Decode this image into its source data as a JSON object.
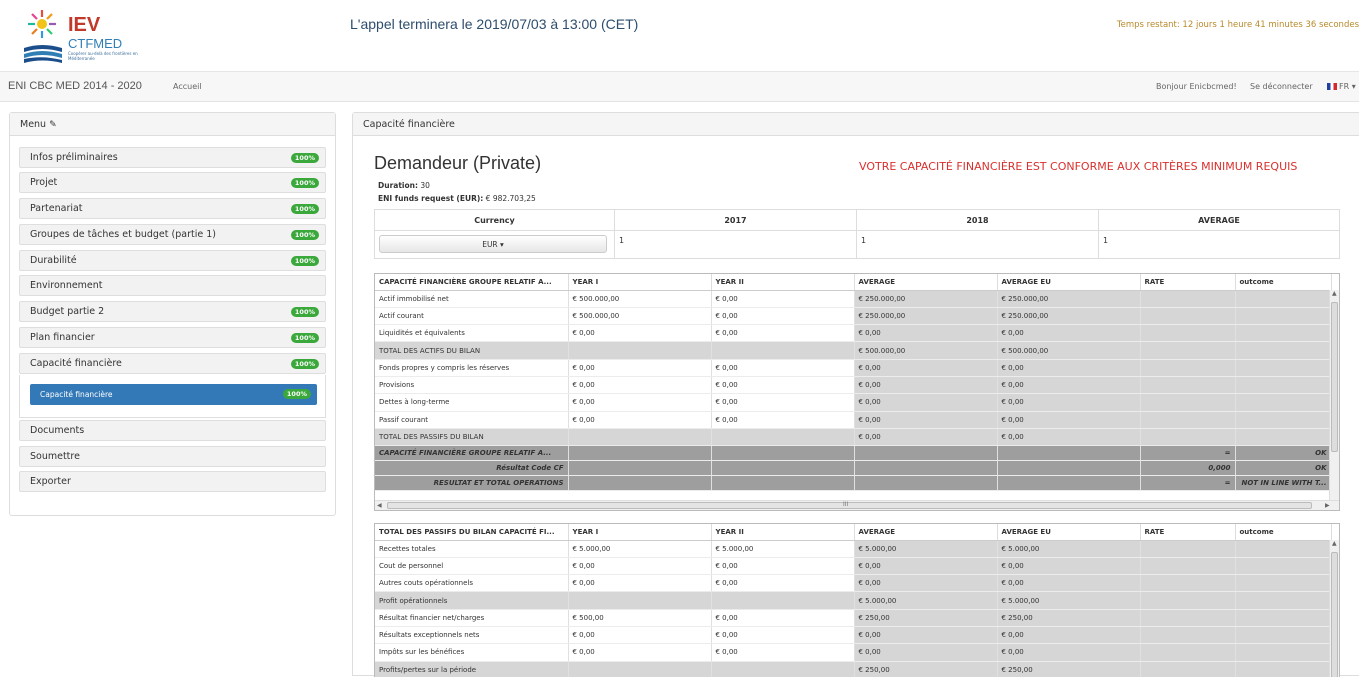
{
  "header": {
    "logo_title": "IEV",
    "logo_subtitle": "CTFMED",
    "logo_tagline": "Coopérer au-delà des frontières en Méditerranée",
    "call_deadline": "L'appel terminera le 2019/07/03 à 13:00 (CET)",
    "time_left": "Temps restant: 12 jours 1 heure 41 minutes 36 secondes"
  },
  "navbar": {
    "brand": "ENI CBC MED 2014 - 2020",
    "home": "Accueil",
    "greeting": "Bonjour Enicbcmed!",
    "logout": "Se déconnecter",
    "language": "FR ▾"
  },
  "menu": {
    "title": "Menu",
    "items": [
      {
        "label": "Infos préliminaires",
        "badge": "100%"
      },
      {
        "label": "Projet",
        "badge": "100%"
      },
      {
        "label": "Partenariat",
        "badge": "100%"
      },
      {
        "label": "Groupes de tâches et budget (partie 1)",
        "badge": "100%"
      },
      {
        "label": "Durabilité",
        "badge": "100%"
      },
      {
        "label": "Environnement",
        "badge": ""
      },
      {
        "label": "Budget partie 2",
        "badge": "100%"
      },
      {
        "label": "Plan financier",
        "badge": "100%"
      },
      {
        "label": "Capacité financière",
        "badge": "100%"
      },
      {
        "label": "Documents",
        "badge": ""
      },
      {
        "label": "Soumettre",
        "badge": ""
      },
      {
        "label": "Exporter",
        "badge": ""
      }
    ],
    "sub_active": {
      "label": "Capacité financière",
      "badge": "100%"
    }
  },
  "main": {
    "panel_title": "Capacité financière",
    "applicant_title": "Demandeur (Private)",
    "status_message": "VOTRE CAPACITÉ FINANCIÈRE EST CONFORME AUX CRITÈRES MINIMUM REQUIS",
    "duration_label": "Duration:",
    "duration_value": "30",
    "funds_label": "ENI funds request (EUR):",
    "funds_value": "€ 982.703,25",
    "currency_table": {
      "headers": [
        "Currency",
        "2017",
        "2018",
        "AVERAGE"
      ],
      "currency_value": "EUR ▾",
      "values": [
        "1",
        "1",
        "1"
      ]
    }
  },
  "grid1": {
    "headers": [
      "CAPACITÉ FINANCIÈRE GROUPE RELATIF A...",
      "YEAR I",
      "YEAR II",
      "AVERAGE",
      "AVERAGE EU",
      "RATE",
      "outcome"
    ],
    "rows": [
      [
        "Actif immobilisé net",
        "€ 500.000,00",
        "€ 0,00",
        "€ 250.000,00",
        "€ 250.000,00",
        "",
        ""
      ],
      [
        "Actif courant",
        "€ 500.000,00",
        "€ 0,00",
        "€ 250.000,00",
        "€ 250.000,00",
        "",
        ""
      ],
      [
        "Liquidités et équivalents",
        "€ 0,00",
        "€ 0,00",
        "€ 0,00",
        "€ 0,00",
        "",
        ""
      ],
      [
        "TOTAL DES ACTIFS DU BILAN",
        "",
        "",
        "€ 500.000,00",
        "€ 500.000,00",
        "",
        ""
      ],
      [
        "Fonds propres y compris les réserves",
        "€ 0,00",
        "€ 0,00",
        "€ 0,00",
        "€ 0,00",
        "",
        ""
      ],
      [
        "Provisions",
        "€ 0,00",
        "€ 0,00",
        "€ 0,00",
        "€ 0,00",
        "",
        ""
      ],
      [
        "Dettes à long-terme",
        "€ 0,00",
        "€ 0,00",
        "€ 0,00",
        "€ 0,00",
        "",
        ""
      ],
      [
        "Passif courant",
        "€ 0,00",
        "€ 0,00",
        "€ 0,00",
        "€ 0,00",
        "",
        ""
      ],
      [
        "TOTAL DES PASSIFS DU BILAN",
        "",
        "",
        "€ 0,00",
        "€ 0,00",
        "",
        ""
      ]
    ],
    "summary": [
      [
        "CAPACITÉ FINANCIÈRE GROUPE RELATIF A...",
        "=",
        "OK"
      ],
      [
        "Résultat Code CF",
        "0,000",
        "OK"
      ],
      [
        "RESULTAT ET TOTAL OPERATIONS",
        "=",
        "NOT IN LINE WITH T..."
      ]
    ],
    "scroll_mark": "III"
  },
  "grid2": {
    "headers": [
      "TOTAL DES PASSIFS DU BILAN CAPACITÉ FI...",
      "YEAR I",
      "YEAR II",
      "AVERAGE",
      "AVERAGE EU",
      "RATE",
      "outcome"
    ],
    "rows": [
      [
        "Recettes totales",
        "€ 5.000,00",
        "€ 5.000,00",
        "€ 5.000,00",
        "€ 5.000,00",
        "",
        ""
      ],
      [
        "Cout de personnel",
        "€ 0,00",
        "€ 0,00",
        "€ 0,00",
        "€ 0,00",
        "",
        ""
      ],
      [
        "Autres couts opérationnels",
        "€ 0,00",
        "€ 0,00",
        "€ 0,00",
        "€ 0,00",
        "",
        ""
      ],
      [
        "Profit opérationnels",
        "",
        "",
        "€ 5.000,00",
        "€ 5.000,00",
        "",
        ""
      ],
      [
        "Résultat financier net/charges",
        "€ 500,00",
        "€ 0,00",
        "€ 250,00",
        "€ 250,00",
        "",
        ""
      ],
      [
        "Résultats exceptionnels nets",
        "€ 0,00",
        "€ 0,00",
        "€ 0,00",
        "€ 0,00",
        "",
        ""
      ],
      [
        "Impôts sur les bénéfices",
        "€ 0,00",
        "€ 0,00",
        "€ 0,00",
        "€ 0,00",
        "",
        ""
      ],
      [
        "Profits/pertes sur la période",
        "",
        "",
        "€ 250,00",
        "€ 250,00",
        "",
        ""
      ]
    ]
  },
  "colors": {
    "accent": "#3379b7",
    "badge": "#3aa83a",
    "alert": "#d9302c",
    "gray_cell": "#d6d6d6"
  }
}
